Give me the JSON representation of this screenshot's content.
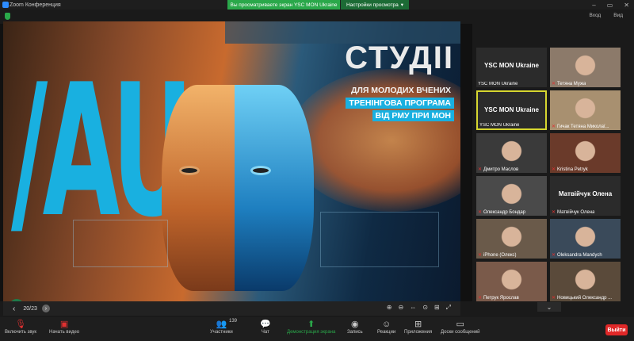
{
  "window": {
    "title": "Zoom Конференция",
    "share_banner": "Вы просматриваете экран YSC MON Ukraine",
    "view_settings": "Настройки просмотра",
    "controls": [
      "–",
      "▭",
      "✕"
    ]
  },
  "subbar": {
    "enter_label": "Вход",
    "view_label": "Вид"
  },
  "slide": {
    "big_letters": "/AU",
    "header_big": "СТУДІІ",
    "line1": "ДЛЯ МОЛОДИХ ВЧЕНИХ",
    "line2": "ТРЕНІНГОВА ПРОГРАМА",
    "line3": "ВІД РМУ ПРИ МОН"
  },
  "slide_nav": {
    "prev": "‹",
    "count": "20/23",
    "next": "›",
    "tools": [
      "⊕",
      "⊖",
      "⇔",
      "⊙",
      "⊞",
      "⤢"
    ]
  },
  "gallery": {
    "tiles": [
      {
        "name": "YSC MON Ukraine",
        "big": "YSC MON Ukraine",
        "muted": false,
        "active": false,
        "color": "#2b2b2b"
      },
      {
        "name": "Тетяна Мужа",
        "big": "",
        "muted": true,
        "active": false,
        "color": "#8c7a6a"
      },
      {
        "name": "YSC MON Ukraine",
        "big": "YSC MON Ukraine",
        "muted": false,
        "active": true,
        "color": "#2b2b2b"
      },
      {
        "name": "Гичак Тетяна Миколаї...",
        "big": "",
        "muted": true,
        "active": false,
        "color": "#a89070"
      },
      {
        "name": "Дмитро Маслов",
        "big": "",
        "muted": true,
        "active": false,
        "color": "#3a3a3a"
      },
      {
        "name": "Kristina Petryk",
        "big": "",
        "muted": true,
        "active": false,
        "color": "#6a3a2a"
      },
      {
        "name": "Олександр Бондар",
        "big": "",
        "muted": true,
        "active": false,
        "color": "#4a4a4a"
      },
      {
        "name": "Матвійчук Олена",
        "big": "Матвійчук Олена",
        "muted": true,
        "active": false,
        "color": "#2b2b2b"
      },
      {
        "name": "iPhone (Олекс)",
        "big": "",
        "muted": true,
        "active": false,
        "color": "#6a5a4a"
      },
      {
        "name": "Oleksandra Mandych",
        "big": "",
        "muted": true,
        "active": false,
        "color": "#3a4a5a"
      },
      {
        "name": "Петрук Ярослав",
        "big": "",
        "muted": true,
        "active": false,
        "color": "#7a5a4a"
      },
      {
        "name": "Новицький Олександр ...",
        "big": "",
        "muted": true,
        "active": false,
        "color": "#5a4a3a"
      }
    ]
  },
  "toolbar": {
    "audio": "Включить звук",
    "video": "Начать видео",
    "participants": "Участники",
    "participants_count": "139",
    "chat": "Чат",
    "share": "Демонстрация экрана",
    "record": "Запись",
    "reactions": "Реакции",
    "apps": "Приложения",
    "whiteboard": "Доски сообщений",
    "leave": "Выйти"
  }
}
